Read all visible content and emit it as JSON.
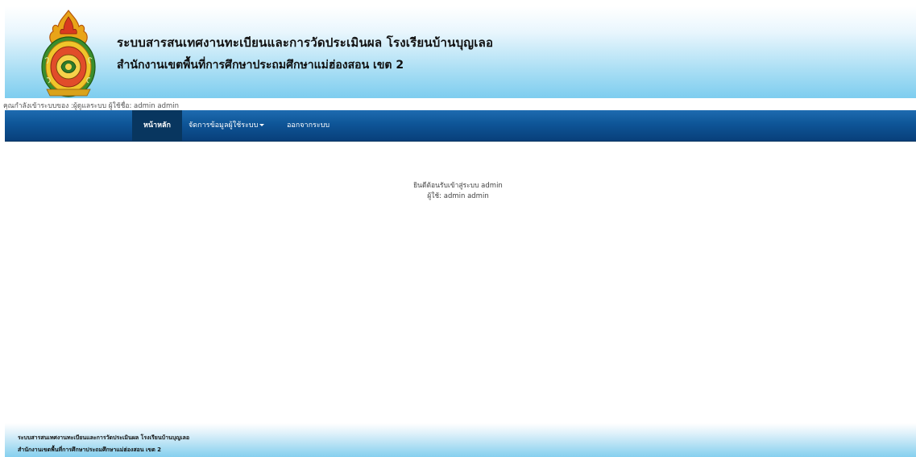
{
  "header": {
    "title": "ระบบสารสนเทศงานทะเบียนและการวัดประเมินผล โรงเรียนบ้านบุญเลอ",
    "subtitle": "สำนักงานเขตพื้นที่การศึกษาประถมศึกษาแม่ฮ่องสอน เขต 2",
    "logo_icon": "school-district-seal-icon"
  },
  "login_status": "คุณกำลังเข้าระบบของ :ผู้ดูแลระบบ ผู้ใช้ชื่อ: admin admin",
  "nav": {
    "home_label": "หน้าหลัก",
    "manage_label": "จัดการข้อมูลผู้ใช้ระบบ",
    "logout_label": "ออกจากระบบ"
  },
  "welcome": {
    "line1": "ยินดีต้อนรับเข้าสู่ระบบ admin",
    "line2": "ผู้ใช้: admin admin"
  },
  "footer": {
    "line1": "ระบบสารสนเทศงานทะเบียนและการวัดประเมินผล โรงเรียนบ้านบุญเลอ",
    "line2": "สำนักงานเขตพื้นที่การศึกษาประถมศึกษาแม่ฮ่องสอน เขต 2"
  },
  "colors": {
    "navbar": "#0e5597",
    "navbar_active": "#08365f",
    "header_gradient_end": "#7dcdef"
  }
}
